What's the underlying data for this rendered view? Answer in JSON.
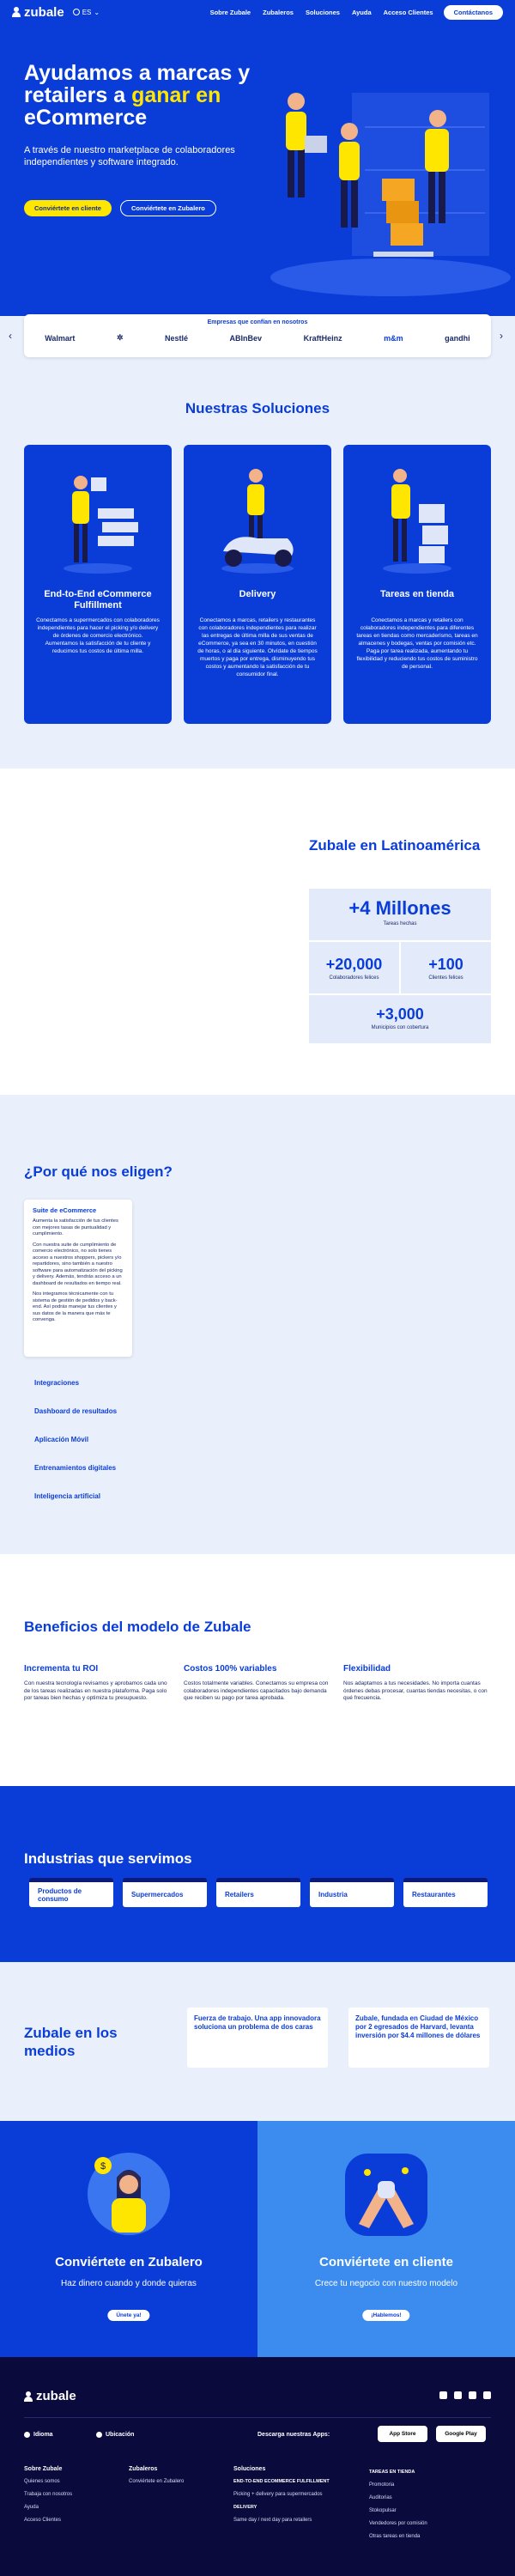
{
  "nav": {
    "logo": "zubale",
    "lang": "ES",
    "links": [
      "Sobre Zubale",
      "Zubaleros",
      "Soluciones",
      "Ayuda",
      "Acceso Clientes"
    ],
    "contact": "Contáctanos"
  },
  "hero": {
    "title_pre": "Ayudamos a marcas y retailers a ",
    "title_hl": "ganar en",
    "title_post": " eCommerce",
    "subtitle": "A través de nuestro marketplace de colaboradores independientes y software integrado.",
    "btn_client": "Conviértete en cliente",
    "btn_zubalero": "Conviértete en Zubalero"
  },
  "brands": {
    "title": "Empresas que confían en nosotros",
    "items": [
      "Walmart",
      "✲",
      "Nestlé",
      "ABInBev",
      "KraftHeinz",
      "m&m",
      "gandhi"
    ]
  },
  "solutions": {
    "title": "Nuestras Soluciones",
    "cards": [
      {
        "title": "End-to-End eCommerce Fulfillment",
        "text": "Conectamos a supermercados con colaboradores independientes para hacer el picking y/o delivery de órdenes de comercio electrónico. Aumentamos la satisfacción de tu cliente y reducimos tus costos de última milla."
      },
      {
        "title": "Delivery",
        "text": "Conectamos a marcas, retailers y restaurantes con colaboradores independientes para realizar las entregas de última milla de sus ventas de eCommerce, ya sea en 30 minutos, en cuestión de horas, o al día siguiente. Olvídate de tiempos muertos y paga por entrega, disminuyendo tus costos y aumentando la satisfacción de tu consumidor final."
      },
      {
        "title": "Tareas en tienda",
        "text": "Conectamos a marcas y retailers con colaboradores independientes para diferentes tareas en tiendas como mercaderismo, tareas en almacenes y bodegas, ventas por comisión etc. Paga por tarea realizada, aumentando tu flexibilidad y reduciendo tus costos de suministro de personal."
      }
    ]
  },
  "latam": {
    "title": "Zubale en Latinoamérica",
    "stats": [
      {
        "value": "+4 Millones",
        "label": "Tareas hechas"
      },
      {
        "value": "+20,000",
        "label": "Colaboradores felices"
      },
      {
        "value": "+100",
        "label": "Clientes felices"
      },
      {
        "value": "+3,000",
        "label": "Municipios con cobertura"
      }
    ]
  },
  "why": {
    "title": "¿Por qué nos eligen?",
    "active_title": "Suite de eCommerce",
    "active_paragraphs": [
      "Aumenta la satisfacción de tus clientes con mejores tasas de puntualidad y cumplimiento.",
      "Con nuestra suite de cumplimiento de comercio electrónico, no solo tienes acceso a nuestros shoppers, pickers y/o repartidores, sino también a nuestro software para automatización del picking y delivery. Además, tendrás acceso a un dashboard de resultados en tiempo real.",
      "Nos integramos técnicamente con tu sistema de gestión de pedidos y back-end. Así podrás manejar tus clientes y sus datos de la manera que más te convenga."
    ],
    "items": [
      "Integraciones",
      "Dashboard de resultados",
      "Aplicación Móvil",
      "Entrenamientos digitales",
      "Inteligencia artificial"
    ]
  },
  "benefits": {
    "title": "Beneficios del modelo de Zubale",
    "items": [
      {
        "title": "Incrementa tu ROI",
        "text": "Con nuestra tecnología revisamos y aprobamos cada uno de los tareas realizadas en nuestra plataforma. Paga solo por tareas bien hechas y optimiza tu presupuesto."
      },
      {
        "title": "Costos 100% variables",
        "text": "Costos totalmente variables. Conectamos su empresa con colaboradores independientes capacitados bajo demanda que reciben su pago por tarea aprobada."
      },
      {
        "title": "Flexibilidad",
        "text": "Nos adaptamos a tus necesidades. No importa cuantas órdenes debas procesar, cuantas tiendas necesitas, o con qué frecuencia."
      }
    ]
  },
  "industries": {
    "title": "Industrias que servimos",
    "items": [
      "Productos de consumo",
      "Supermercados",
      "Retailers",
      "Industria",
      "Restaurantes"
    ]
  },
  "media": {
    "title": "Zubale en los medios",
    "items": [
      "Fuerza de trabajo. Una app innovadora soluciona un problema de dos caras",
      "Zubale, fundada en Ciudad de México por 2 egresados de Harvard, levanta inversión por $4.4 millones de dólares"
    ]
  },
  "cta": {
    "left_title": "Conviértete en Zubalero",
    "left_text": "Haz dinero cuando y donde quieras",
    "left_btn": "Únete ya!",
    "right_title": "Conviértete en cliente",
    "right_text": "Crece tu negocio con nuestro modelo",
    "right_btn": "¡Hablemos!"
  },
  "footer": {
    "logo": "zubale",
    "idioma": "Idioma",
    "ubicacion": "Ubicación",
    "apps_label": "Descarga nuestras Apps:",
    "app_store": "App Store",
    "google_play": "Google Play",
    "col1_title": "Sobre Zubale",
    "col1": [
      "Quienes somos",
      "Trabaja con nosotros",
      "Ayuda",
      "Acceso Clientes"
    ],
    "col2_title": "Zubaleros",
    "col2": [
      "Conviértete en Zubalero"
    ],
    "col3_title": "Soluciones",
    "col3_sub1": "END-TO-END ECOMMERCE FULFILLMENT",
    "col3_a": [
      "Picking + delivery para supermercados"
    ],
    "col3_sub2": "DELIVERY",
    "col3_b": [
      "Same day / next day para retailers"
    ],
    "col4_sub": "TAREAS EN TIENDA",
    "col4": [
      "Promotoria",
      "Auditorias",
      "Stokopulsar",
      "Vendedores por comisión",
      "Otras tareas en tienda"
    ]
  },
  "colors": {
    "primary": "#0a3dd8",
    "accent": "#ffe600",
    "footer": "#0a0a3c",
    "light": "#eaf0fb"
  }
}
